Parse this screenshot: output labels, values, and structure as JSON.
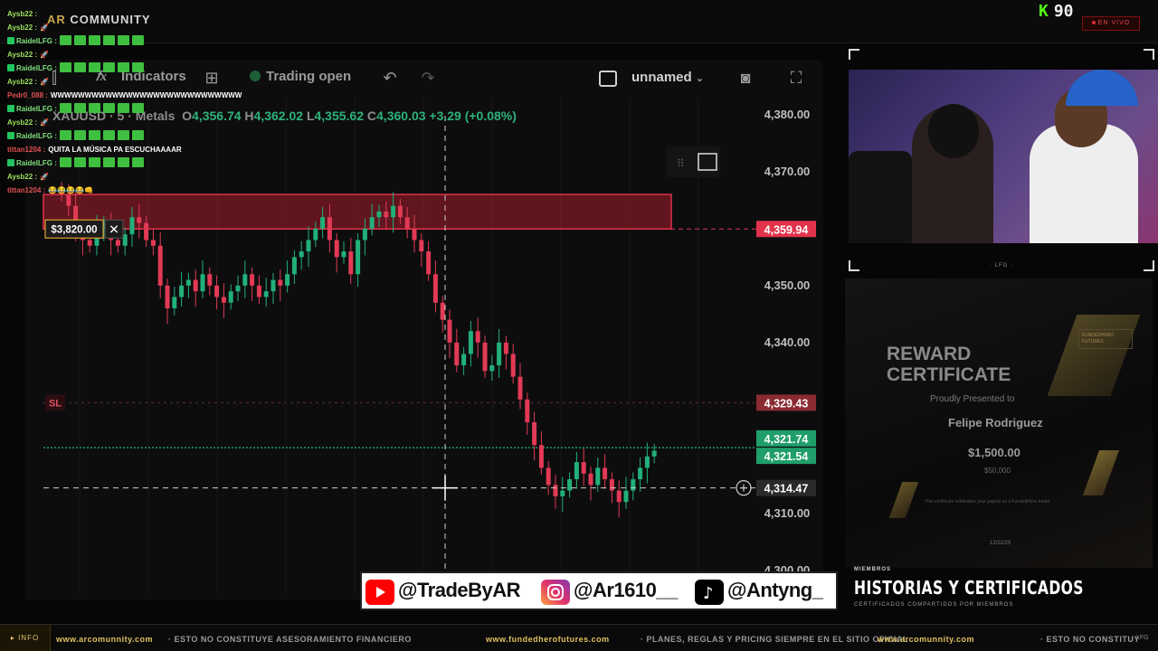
{
  "stream": {
    "brand_prefix": "AR",
    "brand_suffix": " COMMUNITY",
    "viewer_icon": "K",
    "viewer_count": "90",
    "live_label": "EN VIVO"
  },
  "chat": [
    {
      "user": "Aysb22 :",
      "color": "#9be15d",
      "text": ""
    },
    {
      "user": "Aysb22 :",
      "color": "#9be15d",
      "text": "",
      "emote": "rocket"
    },
    {
      "user": "RaidelLFG :",
      "color": "#7ee07e",
      "badge": true,
      "emotes": 6
    },
    {
      "user": "Aysb22 :",
      "color": "#9be15d",
      "text": "",
      "emote": "rocket"
    },
    {
      "user": "RaidelLFG :",
      "color": "#7ee07e",
      "badge": true,
      "emotes": 6
    },
    {
      "user": "Aysb22 :",
      "color": "#9be15d",
      "text": "",
      "emote": "rocket"
    },
    {
      "user": "Pedr0_088 :",
      "color": "#e05050",
      "text": "WWWWWWWWWWWWWWWWWWWWWWWWWWWW"
    },
    {
      "user": "RaidelLFG :",
      "color": "#7ee07e",
      "badge": true,
      "emotes": 6
    },
    {
      "user": "Aysb22 :",
      "color": "#9be15d",
      "text": "",
      "emote": "rocket"
    },
    {
      "user": "RaidelLFG :",
      "color": "#7ee07e",
      "badge": true,
      "emotes": 6
    },
    {
      "user": "tittan1204 :",
      "color": "#e05050",
      "text": "QUITA LA MÚSICA PA ESCUCHAAAAR"
    },
    {
      "user": "RaidelLFG :",
      "color": "#7ee07e",
      "badge": true,
      "emotes": 6
    },
    {
      "user": "Aysb22 :",
      "color": "#9be15d",
      "text": "",
      "emote": "rocket"
    },
    {
      "user": "tittan1204 :",
      "color": "#e05050",
      "text": "😂😂😂😂👊"
    }
  ],
  "toolbar": {
    "indicators": "Indicators",
    "trading_status": "Trading open",
    "layout_name": "unnamed"
  },
  "legend": {
    "symbol": "XAUUSD · 5 · Metals",
    "o_label": "O",
    "o": "4,356.74",
    "h_label": "H",
    "h": "4,362.02",
    "l_label": "L",
    "l": "4,355.62",
    "c_label": "C",
    "c": "4,360.03",
    "change": "+3.29 (+0.08%)"
  },
  "chart_data": {
    "type": "candlestick",
    "symbol": "XAUUSD",
    "interval": "5",
    "y_ticks": [
      4300.0,
      4310.0,
      4340.0,
      4350.0,
      4370.0,
      4380.0
    ],
    "y_tick_labels": [
      "4,300.00",
      "4,310.00",
      "4,340.00",
      "4,350.00",
      "4,370.00",
      "4,380.00"
    ],
    "ylim": [
      4296,
      4383
    ],
    "price_tags": [
      {
        "label": "4,359.94",
        "value": 4359.94,
        "color": "#e0334a"
      },
      {
        "label": "4,329.43",
        "value": 4329.43,
        "color": "#8a2a32"
      },
      {
        "label": "4,321.74",
        "value": 4321.74,
        "color": "#1f9e6a"
      },
      {
        "label": "4,321.54",
        "value": 4321.54,
        "color": "#1f9e6a"
      },
      {
        "label": "4,314.47",
        "value": 4314.47,
        "color": "#2a2a2a"
      }
    ],
    "position_label": "$3,820.00",
    "sl_label": "SL",
    "sl_price": 4329.43,
    "entry_price": 4359.94,
    "zone_top": 4366.0,
    "zone_bottom": 4359.94,
    "cursor_price": 4314.47,
    "current_price": 4321.54,
    "closes": [
      4366,
      4364,
      4360,
      4358,
      4357,
      4360,
      4361,
      4358,
      4357,
      4359,
      4362,
      4361,
      4358,
      4357,
      4350,
      4346,
      4348,
      4350,
      4351,
      4349,
      4352,
      4350,
      4348,
      4347,
      4349,
      4350,
      4352,
      4350,
      4348,
      4349,
      4351,
      4350,
      4352,
      4355,
      4356,
      4358,
      4360,
      4362,
      4358,
      4355,
      4356,
      4352,
      4358,
      4360,
      4362,
      4363,
      4362,
      4364,
      4362,
      4360,
      4358,
      4356,
      4352,
      4347,
      4344,
      4340,
      4336,
      4338,
      4342,
      4340,
      4335,
      4336,
      4340,
      4338,
      4334,
      4330,
      4326,
      4322,
      4318,
      4315,
      4313,
      4314,
      4316,
      4319,
      4317,
      4315,
      4318,
      4316,
      4314,
      4312,
      4314,
      4316,
      4318,
      4320,
      4321
    ]
  },
  "cert": {
    "reward_line1": "REWARD",
    "reward_line2": "CERTIFICATE",
    "presented": "Proudly Presented to",
    "name": "Felipe Rodriguez",
    "amount": "$1,500.00",
    "sub_amount": "$50,000",
    "date": "12/22/25",
    "logo": "FUNDEDHERO FUTURES",
    "body": "This certificate celebrates your payout as a FundedHero trader"
  },
  "historias": {
    "label": "MIEMBROS",
    "title": "HISTORIAS Y CERTIFICADOS",
    "sub": "CERTIFICADOS COMPARTIDOS POR MIEMBROS"
  },
  "social": {
    "youtube": "@TradeByAR",
    "instagram": "@Ar1610__",
    "tiktok": "@Antyng_"
  },
  "ticker": {
    "info": "INFO",
    "items": [
      {
        "text": "www.arcomunnity.com",
        "style": "y"
      },
      {
        "text": "·  ESTO NO CONSTITUYE ASESORAMIENTO FINANCIERO",
        "style": "g"
      },
      {
        "text": "www.fundedherofutures.com",
        "style": "y"
      },
      {
        "text": "·  PLANES, REGLAS Y PRICING SIEMPRE EN EL SITIO OFICIAL",
        "style": "g"
      },
      {
        "text": "www.arcomunnity.com",
        "style": "y"
      },
      {
        "text": "·  ESTO NO CONSTITUY",
        "style": "g"
      }
    ],
    "lfg": "LFG"
  },
  "cam": {
    "lfg": "· LFG ·"
  }
}
